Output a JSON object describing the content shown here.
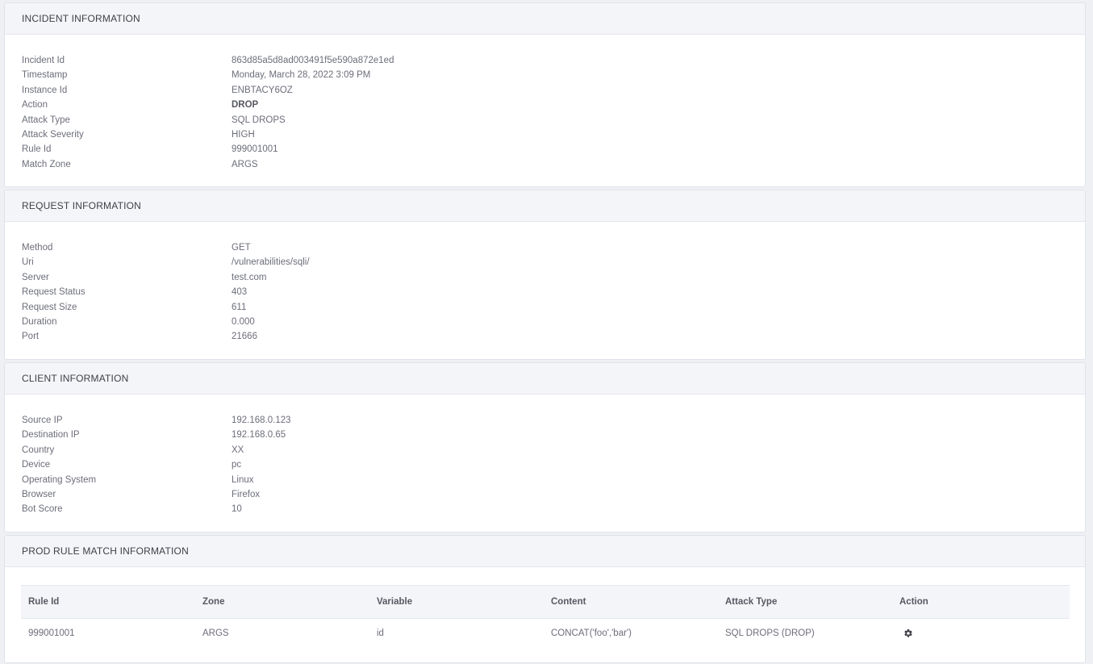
{
  "incident": {
    "title": "INCIDENT INFORMATION",
    "rows": [
      {
        "label": "Incident Id",
        "value": "863d85a5d8ad003491f5e590a872e1ed"
      },
      {
        "label": "Timestamp",
        "value": "Monday, March 28, 2022 3:09 PM"
      },
      {
        "label": "Instance Id",
        "value": "ENBTACY6OZ"
      },
      {
        "label": "Action",
        "value": "DROP"
      },
      {
        "label": "Attack Type",
        "value": "SQL DROPS"
      },
      {
        "label": "Attack Severity",
        "value": "HIGH"
      },
      {
        "label": "Rule Id",
        "value": "999001001"
      },
      {
        "label": "Match Zone",
        "value": "ARGS"
      }
    ]
  },
  "request": {
    "title": "REQUEST INFORMATION",
    "rows": [
      {
        "label": "Method",
        "value": "GET"
      },
      {
        "label": "Uri",
        "value": "/vulnerabilities/sqli/"
      },
      {
        "label": "Server",
        "value": "test.com"
      },
      {
        "label": "Request Status",
        "value": "403"
      },
      {
        "label": "Request Size",
        "value": "611"
      },
      {
        "label": "Duration",
        "value": "0.000"
      },
      {
        "label": "Port",
        "value": "21666"
      }
    ]
  },
  "client": {
    "title": "CLIENT INFORMATION",
    "rows": [
      {
        "label": "Source IP",
        "value": "192.168.0.123"
      },
      {
        "label": "Destination IP",
        "value": "192.168.0.65"
      },
      {
        "label": "Country",
        "value": "XX"
      },
      {
        "label": "Device",
        "value": "pc"
      },
      {
        "label": "Operating System",
        "value": "Linux"
      },
      {
        "label": "Browser",
        "value": "Firefox"
      },
      {
        "label": "Bot Score",
        "value": "10"
      }
    ]
  },
  "rule_match": {
    "title": "PROD RULE MATCH INFORMATION",
    "columns": [
      "Rule Id",
      "Zone",
      "Variable",
      "Content",
      "Attack Type",
      "Action"
    ],
    "rows": [
      {
        "rule_id": "999001001",
        "zone": "ARGS",
        "variable": "id",
        "content": "CONCAT('foo','bar')",
        "attack_type": "SQL DROPS (DROP)",
        "action_icon": "gear-icon"
      }
    ]
  }
}
